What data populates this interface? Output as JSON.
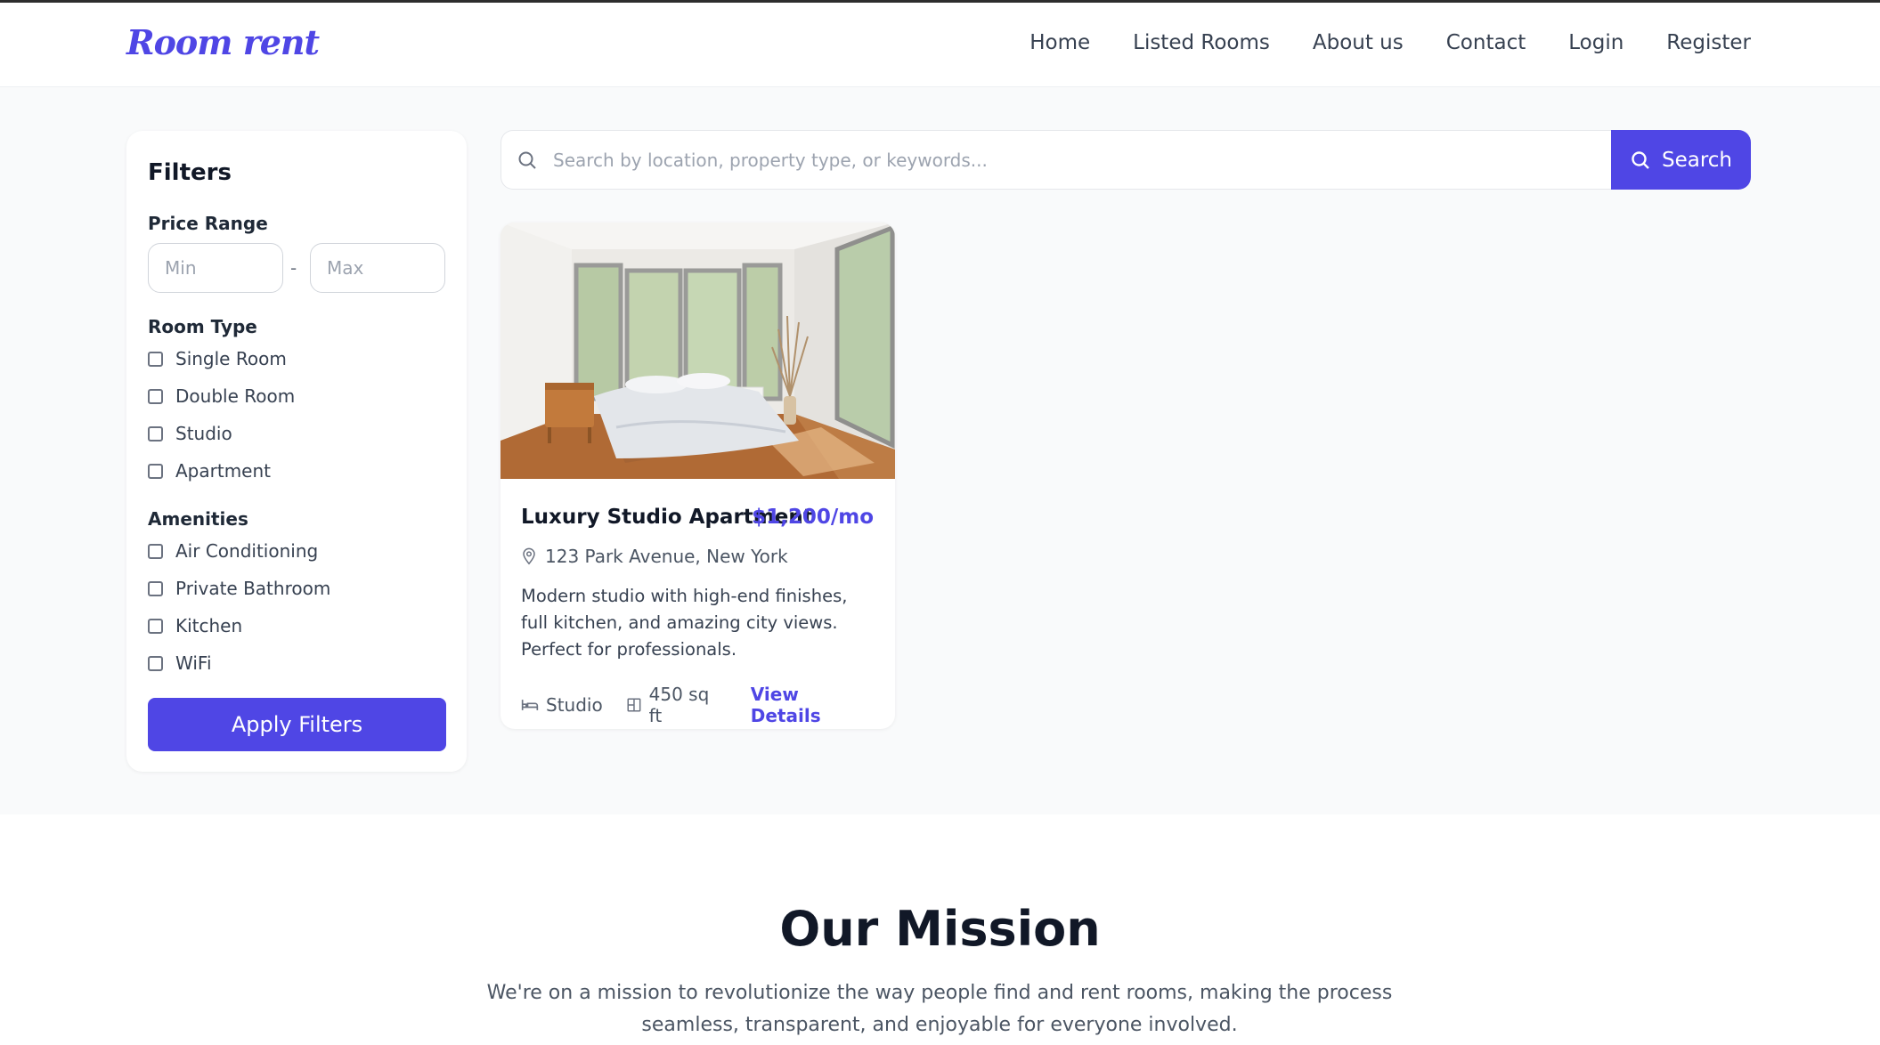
{
  "navbar": {
    "brand": "Room rent",
    "links": [
      "Home",
      "Listed Rooms",
      "About us",
      "Contact",
      "Login",
      "Register"
    ]
  },
  "filters": {
    "title": "Filters",
    "price_range_label": "Price Range",
    "min_placeholder": "Min",
    "max_placeholder": "Max",
    "separator": "-",
    "room_type_label": "Room Type",
    "room_types": [
      "Single Room",
      "Double Room",
      "Studio",
      "Apartment"
    ],
    "amenities_label": "Amenities",
    "amenities": [
      "Air Conditioning",
      "Private Bathroom",
      "Kitchen",
      "WiFi"
    ],
    "apply_label": "Apply Filters"
  },
  "search": {
    "placeholder": "Search by location, property type, or keywords...",
    "button_label": "Search"
  },
  "listing": {
    "title": "Luxury Studio Apartment",
    "price": "$1,200/mo",
    "location": "123 Park Avenue, New York",
    "description": "Modern studio with high-end finishes, full kitchen, and amazing city views. Perfect for professionals.",
    "type": "Studio",
    "size": "450 sq ft",
    "details_label": "View Details"
  },
  "mission": {
    "title": "Our Mission",
    "text": "We're on a mission to revolutionize the way people find and rent rooms, making the process seamless, transparent, and enjoyable for everyone involved."
  },
  "colors": {
    "accent": "#4f46e5",
    "background": "#f9fafb"
  }
}
